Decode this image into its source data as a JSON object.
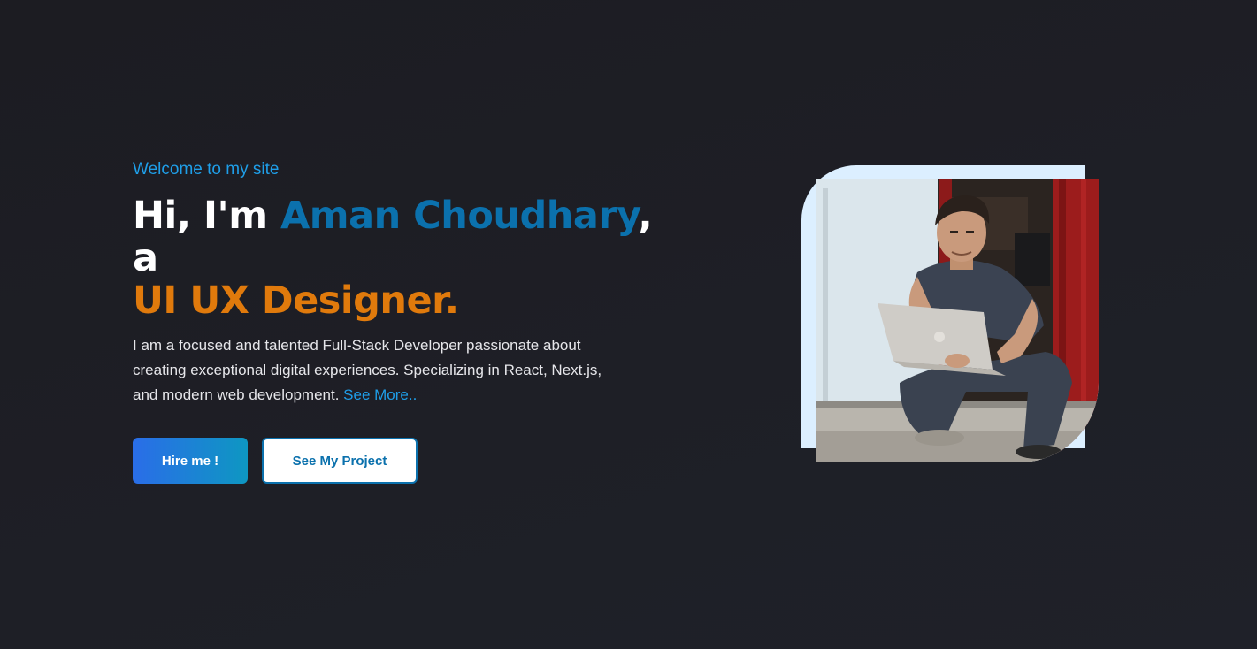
{
  "hero": {
    "welcome": "Welcome to my site",
    "greeting": "Hi, I'm ",
    "name": "Aman Choudhary",
    "connector": ", a",
    "role": "UI UX Designer.",
    "description": "I am a focused and talented Full-Stack Developer passionate about creating exceptional digital experiences. Specializing in React, Next.js, and modern web development. ",
    "see_more": "See More.."
  },
  "actions": {
    "hire_label": "Hire me !",
    "project_label": "See My Project"
  },
  "colors": {
    "background": "#1e1f26",
    "accent_blue": "#1f9ee8",
    "name_blue": "#0b71ad",
    "role_orange": "#e07a0c",
    "frame": "#dcefff"
  },
  "photo": {
    "subject": "man crouching holding a laptop in front of a red door"
  }
}
